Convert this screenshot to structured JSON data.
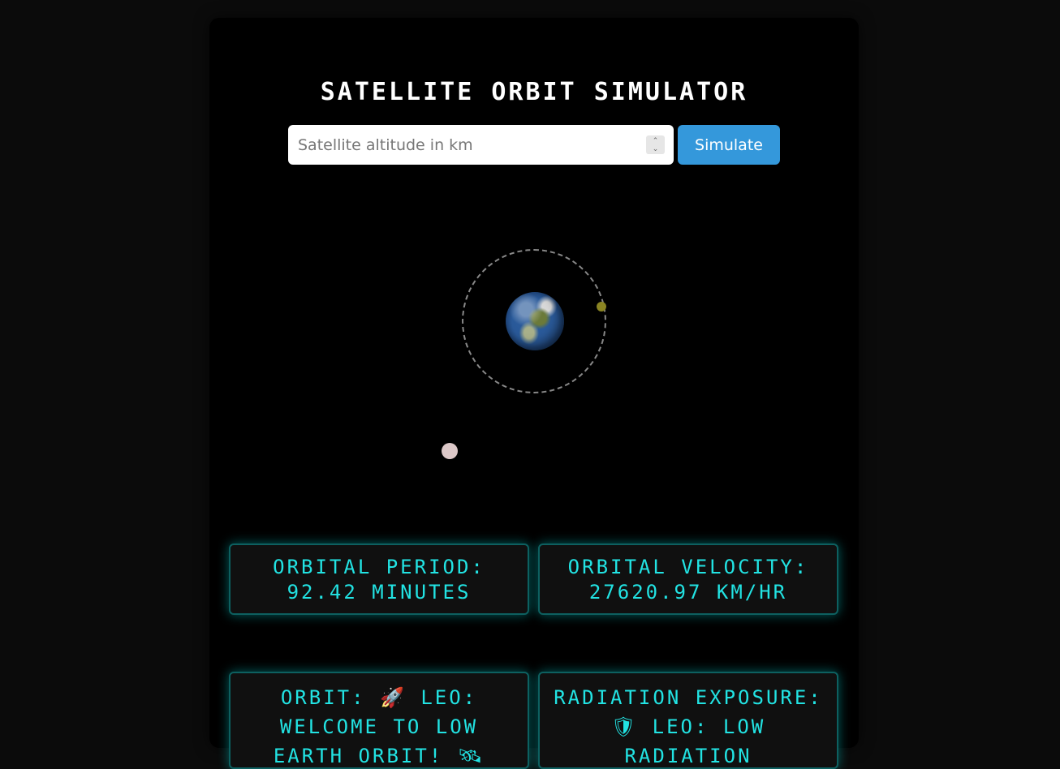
{
  "header": {
    "title": "Satellite Orbit Simulator"
  },
  "form": {
    "altitude_placeholder": "Satellite altitude in km",
    "altitude_value": "",
    "simulate_label": "Simulate"
  },
  "stats": {
    "period": "Orbital Period: 92.42 minutes",
    "velocity": "Orbital Velocity: 27620.97 km/hr",
    "orbit": "Orbit: 🚀 LEO: Welcome to Low Earth Orbit! 🛰",
    "radiation": "Radiation Exposure: 🛡 LEO: Low radiation"
  },
  "colors": {
    "accent": "#3498db",
    "stat_text": "#22e3e3",
    "satellite": "#8a8422",
    "moon": "#dcc8c8"
  }
}
